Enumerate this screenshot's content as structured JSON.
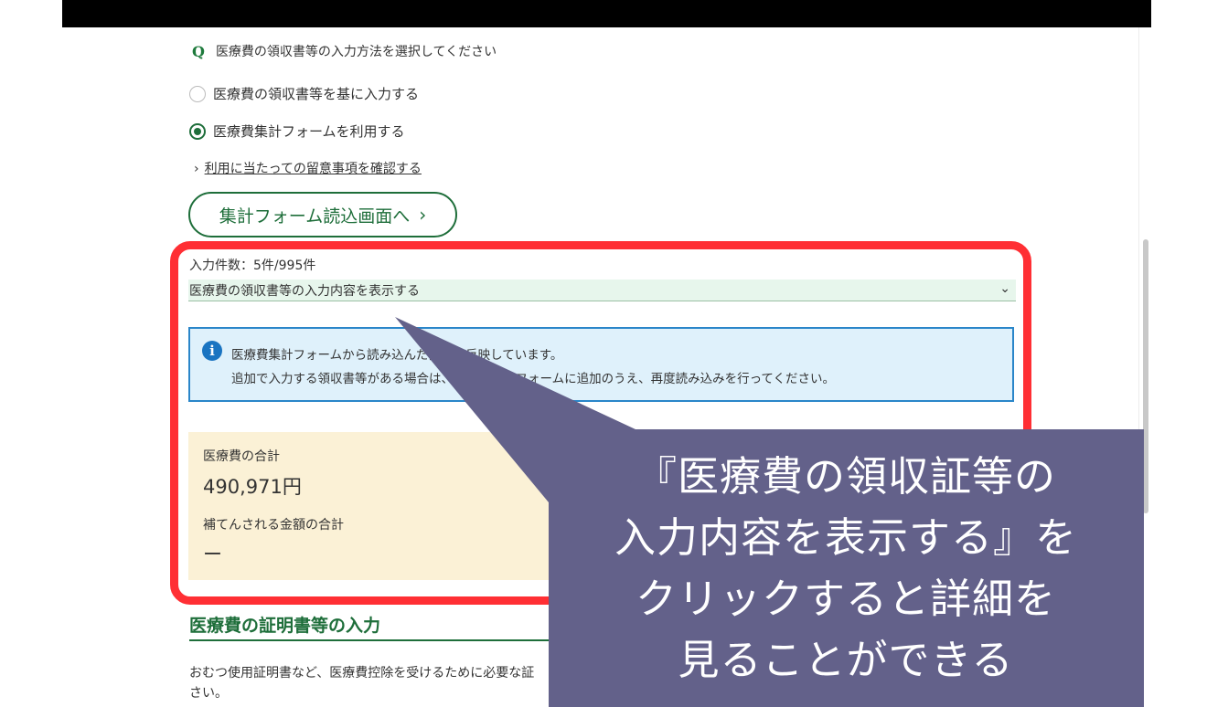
{
  "question": {
    "mark": "Q",
    "text": "医療費の領収書等の入力方法を選択してください"
  },
  "input_method": {
    "options": [
      {
        "label": "医療費の領収書等を基に入力する",
        "checked": false
      },
      {
        "label": "医療費集計フォームを利用する",
        "checked": true
      }
    ]
  },
  "note_link": "利用に当たっての留意事項を確認する",
  "read_button": "集計フォーム読込画面へ",
  "entry_count": "入力件数：5件/995件",
  "accordion_label": "医療費の領収書等の入力内容を表示する",
  "info": {
    "line1": "医療費集計フォームから読み込んだ内容を反映しています。",
    "line2": "追加で入力する領収書等がある場合は、医療費集計フォームに追加のうえ、再度読み込みを行ってください。"
  },
  "totals": {
    "medical_label": "医療費の合計",
    "medical_value": "490,971円",
    "compensated_label": "補てんされる金額の合計",
    "compensated_value": "ー"
  },
  "certificate_section": {
    "title": "医療費の証明書等の入力",
    "body_line1": "おむつ使用証明書など、医療費控除を受けるために必要な証",
    "body_line2": "さい。"
  },
  "callout": {
    "lines": [
      "『医療費の領収証等の",
      "入力内容を表示する』を",
      "クリックすると詳細を",
      "見ることができる"
    ],
    "fill_color": "#63618a"
  },
  "colors": {
    "accent_green": "#1e6e3a",
    "highlight_red": "#ff2f34",
    "info_blue": "#2a86c9"
  }
}
